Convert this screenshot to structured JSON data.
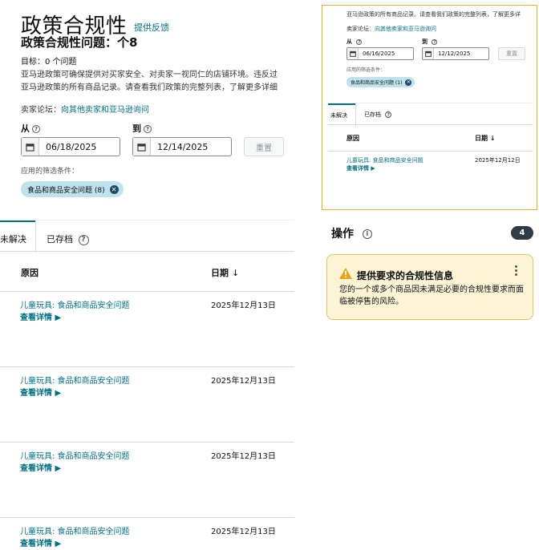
{
  "header": {
    "title": "政策合规性",
    "feedback_link": "提供反馈",
    "issue_title": "政策合规性问题：个8",
    "goal": "目标：0 个问题",
    "policy_line1": "亚马逊政策可确保提供对买家安全、对卖家一视同仁的店铺环境。违反过",
    "policy_line2": "亚马逊政策的所有商品记录。请查看我们政策的完整列表，了解更多详细",
    "forum_label": "卖家论坛：",
    "forum_link": "向其他卖家和亚马逊询问"
  },
  "filters": {
    "from_label": "从",
    "to_label": "到",
    "from_value": "06/18/2025",
    "to_value": "12/14/2025",
    "reset_label": "重置",
    "applied_label": "应用的筛选条件：",
    "chip_label": "食品和商品安全问题 (8)"
  },
  "tabs": {
    "unresolved": "未解决",
    "archived": "已存档"
  },
  "table": {
    "col_reason": "原因",
    "col_date": "日期",
    "rows": [
      {
        "reason": "儿童玩具: 食品和商品安全问题",
        "more": "查看详情 ▶",
        "date": "2025年12月13日"
      },
      {
        "reason": "儿童玩具: 食品和商品安全问题",
        "more": "查看详情 ▶",
        "date": "2025年12月13日"
      },
      {
        "reason": "儿童玩具: 食品和商品安全问题",
        "more": "查看详情 ▶",
        "date": "2025年12月13日"
      },
      {
        "reason": "儿童玩具: 食品和商品安全问题",
        "more": "查看详情 ▶",
        "date": "2025年12月13日"
      }
    ]
  },
  "mini": {
    "text": "亚马逊政策的所有商品记录。请查看我们政策的完整列表，了解更多详",
    "forum_label": "卖家论坛：",
    "forum_link": "向其他卖家和亚马逊询问",
    "from_label": "从",
    "to_label": "到",
    "from_value": "06/16/2025",
    "to_value": "12/12/2025",
    "reset_label": "重置",
    "applied_label": "应用的筛选条件：",
    "chip_label": "食品和商品安全问题 (1)",
    "tab_unresolved": "未解决",
    "tab_archived": "已存档",
    "col_reason": "原因",
    "col_date": "日期 ↓",
    "row_reason": "儿童玩具: 食品和商品安全问题",
    "row_more": "查看详情 ▶",
    "row_date": "2025年12月12日"
  },
  "actions": {
    "title": "操作",
    "count": "4",
    "card_title": "提供要求的合规性信息",
    "card_body": "您的一个或多个商品因未满足必要的合规性要求而面临被停售的风险。"
  },
  "colors": {
    "link": "#007185",
    "chip_bg": "#bfe3ec",
    "alert_bg": "#fcf4d5",
    "alert_border": "#e6c35a",
    "panel_border": "#e6b422"
  }
}
